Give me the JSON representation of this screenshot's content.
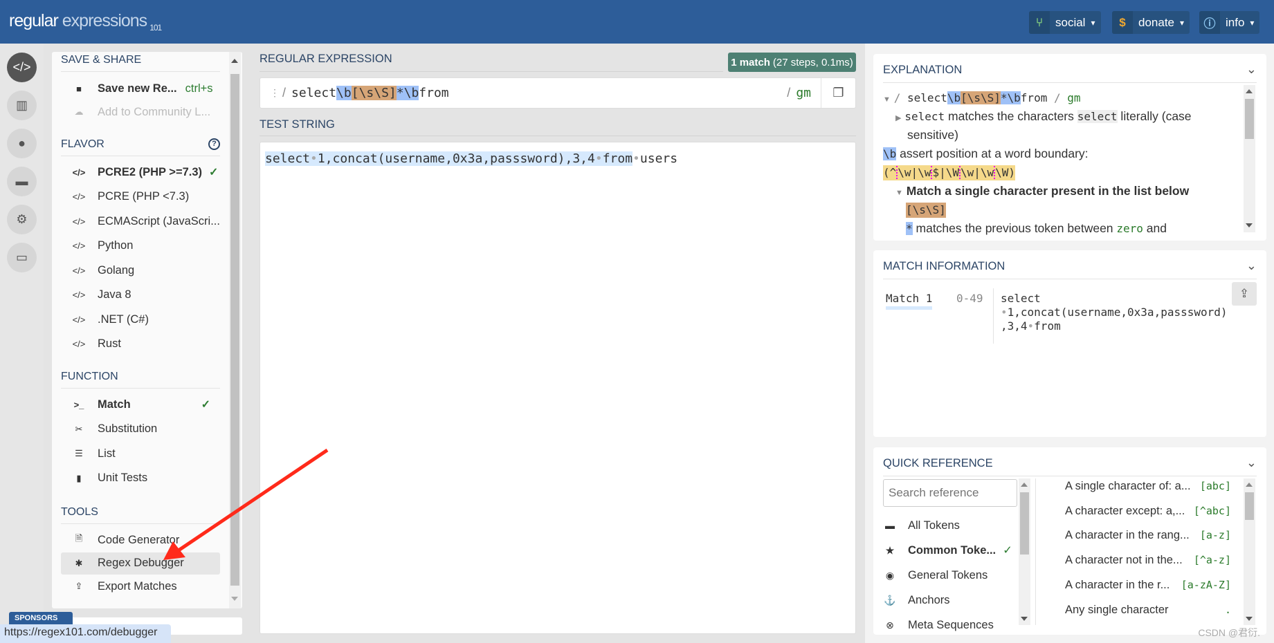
{
  "header": {
    "logo_main": "regular",
    "logo_sub": "expressions",
    "logo_num": "101",
    "buttons": [
      {
        "label": "social",
        "icon": "branch-icon",
        "color": "#7ec77e"
      },
      {
        "label": "donate",
        "icon": "dollar-icon",
        "color": "#f0a830"
      },
      {
        "label": "info",
        "icon": "info-icon",
        "color": "#8cc6f0"
      }
    ]
  },
  "rail": [
    "code-icon",
    "library-icon",
    "user-icon",
    "gamepad-icon",
    "settings-icon",
    "chat-icon"
  ],
  "sidebar": {
    "save_share": {
      "title": "SAVE & SHARE",
      "save_label": "Save new Re...",
      "save_shortcut": "ctrl+s",
      "community_label": "Add to Community L..."
    },
    "flavor": {
      "title": "FLAVOR",
      "items": [
        "PCRE2 (PHP >=7.3)",
        "PCRE (PHP <7.3)",
        "ECMAScript (JavaScri...",
        "Python",
        "Golang",
        "Java 8",
        ".NET (C#)",
        "Rust"
      ],
      "selected": "PCRE2 (PHP >=7.3)"
    },
    "function": {
      "title": "FUNCTION",
      "items": [
        "Match",
        "Substitution",
        "List",
        "Unit Tests"
      ],
      "selected": "Match"
    },
    "tools": {
      "title": "TOOLS",
      "items": [
        "Code Generator",
        "Regex Debugger",
        "Export Matches"
      ],
      "hovered": "Regex Debugger"
    },
    "sponsors_label": "SPONSORS"
  },
  "regex": {
    "title": "REGULAR EXPRESSION",
    "badge_bold": "1 match",
    "badge_rest": "(27 steps, 0.1ms)",
    "delimiter": "/",
    "parts": [
      "select",
      "\\b",
      "[\\s\\S]",
      "*\\b",
      "from"
    ],
    "flags": "gm"
  },
  "test_string": {
    "title": "TEST STRING",
    "matched": [
      "select",
      "1,concat(username,0x3a,passsword),3,4",
      "from"
    ],
    "unmatched": "users"
  },
  "explanation": {
    "title": "EXPLANATION",
    "line1_parts": [
      "/ ",
      "select",
      "\\b",
      "[\\s\\S]",
      "*\\b",
      "from",
      " / ",
      "gm"
    ],
    "line2_token": "select",
    "line2_text_a": " matches the characters ",
    "line2_code": "select",
    "line2_text_b": " literally (case",
    "line3": "sensitive)",
    "line4_token": "\\b",
    "line4_text": " assert position at a word boundary:",
    "line5": [
      "(^",
      "\\w|\\w",
      "$|\\W",
      "\\w|\\w",
      "\\W)"
    ],
    "line6": "Match a single character present in the list below",
    "line7": "[\\s\\S]",
    "line8_token": "*",
    "line8_text_a": " matches the previous token between ",
    "line8_code": "zero",
    "line8_text_b": " and"
  },
  "match_info": {
    "title": "MATCH INFORMATION",
    "match_label": "Match 1",
    "range": "0-49",
    "lines": [
      "select",
      "1,concat(username,0x3a,passsword)",
      ",3,4",
      "from"
    ]
  },
  "quick_reference": {
    "title": "QUICK REFERENCE",
    "search_placeholder": "Search reference",
    "categories": [
      {
        "label": "All Tokens",
        "icon": "stack-icon"
      },
      {
        "label": "Common Toke...",
        "icon": "star-icon",
        "selected": true
      },
      {
        "label": "General Tokens",
        "icon": "target-icon"
      },
      {
        "label": "Anchors",
        "icon": "anchor-icon"
      },
      {
        "label": "Meta Sequences",
        "icon": "lifebuoy-icon"
      }
    ],
    "tokens": [
      {
        "desc": "A single character of: a...",
        "token": "[abc]"
      },
      {
        "desc": "A character except: a,...",
        "token": "[^abc]"
      },
      {
        "desc": "A character in the rang...",
        "token": "[a-z]"
      },
      {
        "desc": "A character not in the...",
        "token": "[^a-z]"
      },
      {
        "desc": "A character in the r...",
        "token": "[a-zA-Z]"
      },
      {
        "desc": "Any single character",
        "token": "."
      }
    ]
  },
  "status_url": "https://regex101.com/debugger",
  "watermark": "CSDN @君衍.",
  "colors": {
    "header": "#2d5d99",
    "badge": "#4d8073",
    "boundary": "#9fc1f7",
    "charclass": "#d6a577",
    "match": "#d6e9fd",
    "annotation_arrow": "#ff2a1a"
  }
}
